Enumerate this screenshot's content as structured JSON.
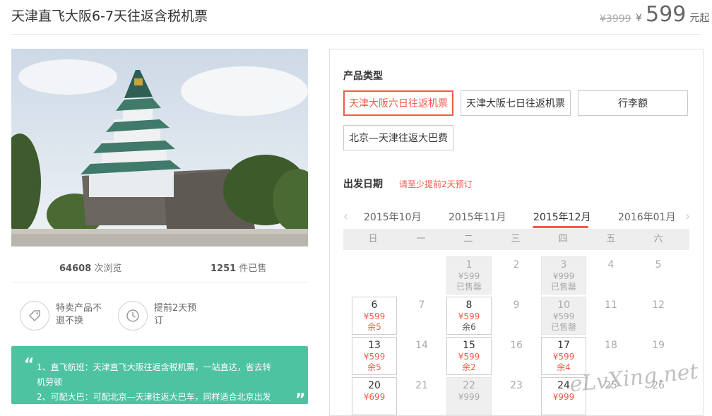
{
  "header": {
    "title": "天津直飞大阪6-7天往返含税机票",
    "original_price": "¥3999",
    "currency_symbol": "¥",
    "price": "599",
    "price_suffix": "元起"
  },
  "stats": {
    "views_num": "64608",
    "views_label": "次浏览",
    "sold_num": "1251",
    "sold_label": "件已售"
  },
  "features": [
    {
      "icon": "tag-icon",
      "text": "特卖产品不退不换"
    },
    {
      "icon": "clock-icon",
      "text": "提前2天预订"
    }
  ],
  "highlights": {
    "text": "1、直飞航班：天津直飞大阪往返含税机票，一站直达，省去转机劳顿\n2、可配大巴：可配北京—天津往返大巴车，同样适合北京出发的"
  },
  "product": {
    "label": "产品类型",
    "options": [
      {
        "label": "天津大阪六日往返机票",
        "selected": true
      },
      {
        "label": "天津大阪七日往返机票",
        "selected": false
      },
      {
        "label": "行李额",
        "selected": false
      },
      {
        "label": "北京—天津往返大巴费",
        "selected": false
      }
    ]
  },
  "departure": {
    "label": "出发日期",
    "notice": "请至少提前2天预订"
  },
  "calendar": {
    "months": [
      "2015年10月",
      "2015年11月",
      "2015年12月",
      "2016年01月"
    ],
    "active_month": "2015年12月",
    "weekdays": [
      "日",
      "一",
      "二",
      "三",
      "四",
      "五",
      "六"
    ],
    "rows": [
      [
        null,
        null,
        {
          "day": "1",
          "price": "¥599",
          "status": "已售罄",
          "state": "sold"
        },
        {
          "day": "2",
          "state": "plain"
        },
        {
          "day": "3",
          "price": "¥999",
          "status": "已售罄",
          "state": "sold"
        },
        {
          "day": "4",
          "state": "plain"
        },
        {
          "day": "5",
          "state": "plain"
        }
      ],
      [
        {
          "day": "6",
          "price": "¥599",
          "status": "余5",
          "state": "avail"
        },
        {
          "day": "7",
          "state": "plain"
        },
        {
          "day": "8",
          "price": "¥599",
          "status": "余6",
          "state": "avail",
          "dark": true
        },
        {
          "day": "9",
          "state": "plain"
        },
        {
          "day": "10",
          "price": "¥599",
          "status": "已售罄",
          "state": "sold"
        },
        {
          "day": "11",
          "state": "plain"
        },
        {
          "day": "12",
          "state": "plain"
        }
      ],
      [
        {
          "day": "13",
          "price": "¥599",
          "status": "余5",
          "state": "avail"
        },
        {
          "day": "14",
          "state": "plain"
        },
        {
          "day": "15",
          "price": "¥599",
          "status": "余2",
          "state": "avail"
        },
        {
          "day": "16",
          "state": "plain"
        },
        {
          "day": "17",
          "price": "¥599",
          "status": "余4",
          "state": "avail"
        },
        {
          "day": "18",
          "state": "plain"
        },
        {
          "day": "19",
          "state": "plain"
        }
      ],
      [
        {
          "day": "20",
          "price": "¥699",
          "status": "",
          "state": "avail"
        },
        {
          "day": "21",
          "state": "plain"
        },
        {
          "day": "22",
          "price": "¥999",
          "status": "",
          "state": "sold"
        },
        {
          "day": "23",
          "state": "plain"
        },
        {
          "day": "24",
          "price": "¥999",
          "status": "",
          "state": "avail"
        },
        {
          "day": "25",
          "state": "plain"
        },
        {
          "day": "26",
          "state": "plain"
        }
      ]
    ]
  },
  "watermark": "eLvXing.net",
  "colors": {
    "accent": "#f25b4b",
    "green": "#4dc3a1"
  }
}
